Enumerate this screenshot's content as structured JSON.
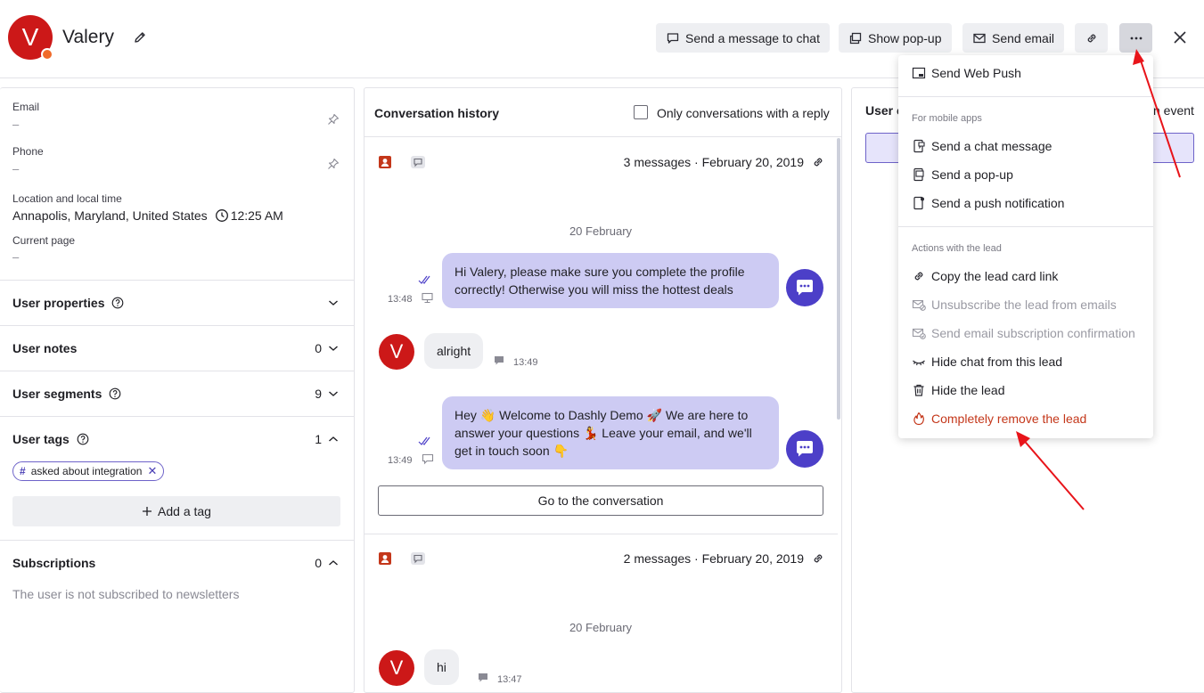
{
  "user": {
    "initial": "V",
    "name": "Valery"
  },
  "header": {
    "send_chat_label": "Send a message to chat",
    "show_popup_label": "Show pop-up",
    "send_email_label": "Send email"
  },
  "fields": {
    "email_label": "Email",
    "email_value": "–",
    "phone_label": "Phone",
    "phone_value": "–",
    "location_label": "Location and local time",
    "location_value": "Annapolis, Maryland, United States",
    "local_time": "12:25 AM",
    "page_label": "Current page",
    "page_value": "–"
  },
  "sections": {
    "properties": "User properties",
    "notes": "User notes",
    "notes_count": "0",
    "segments": "User segments",
    "segments_count": "9",
    "tags": "User tags",
    "tags_count": "1",
    "tag_name": "asked about integration",
    "add_tag": "Add a tag",
    "subscriptions": "Subscriptions",
    "subscriptions_count": "0",
    "subscriptions_empty": "The user is not subscribed to newsletters"
  },
  "conversation": {
    "title": "Conversation history",
    "filter_label": "Only conversations with a reply",
    "conv1": {
      "meta": "3 messages · February 20, 2019",
      "date": "20 February",
      "msg1": "Hi Valery, please make sure you complete the profile correctly! Otherwise you will miss the hottest deals",
      "msg1_time": "13:48",
      "reply": "alright",
      "reply_time": "13:49",
      "msg2": "Hey 👋 Welcome to Dashly Demo 🚀 We are here to answer your questions 💃 Leave your email, and we'll get in touch soon 👇",
      "msg2_time": "13:49",
      "goto": "Go to the conversation"
    },
    "conv2": {
      "meta": "2 messages · February 20, 2019",
      "date": "20 February",
      "reply": "hi",
      "reply_time": "13:47"
    }
  },
  "right_panel": {
    "title_partial": "User e",
    "event_partial": "n event"
  },
  "menu": {
    "web_push": "Send Web Push",
    "group_mobile": "For mobile apps",
    "chat_message": "Send a chat message",
    "popup": "Send a pop-up",
    "push": "Send a push notification",
    "group_lead": "Actions with the lead",
    "copy_link": "Copy the lead card link",
    "unsubscribe": "Unsubscribe the lead from emails",
    "confirm_sub": "Send email subscription confirmation",
    "hide_chat": "Hide chat from this lead",
    "hide_lead": "Hide the lead",
    "remove_lead": "Completely remove the lead"
  },
  "colors": {
    "avatar_red": "#cc1818",
    "operator_purple": "#4c3fc8",
    "bubble_lavender": "#cdcbf3",
    "danger": "#c4371a",
    "annotation_arrow": "#e8141a"
  }
}
